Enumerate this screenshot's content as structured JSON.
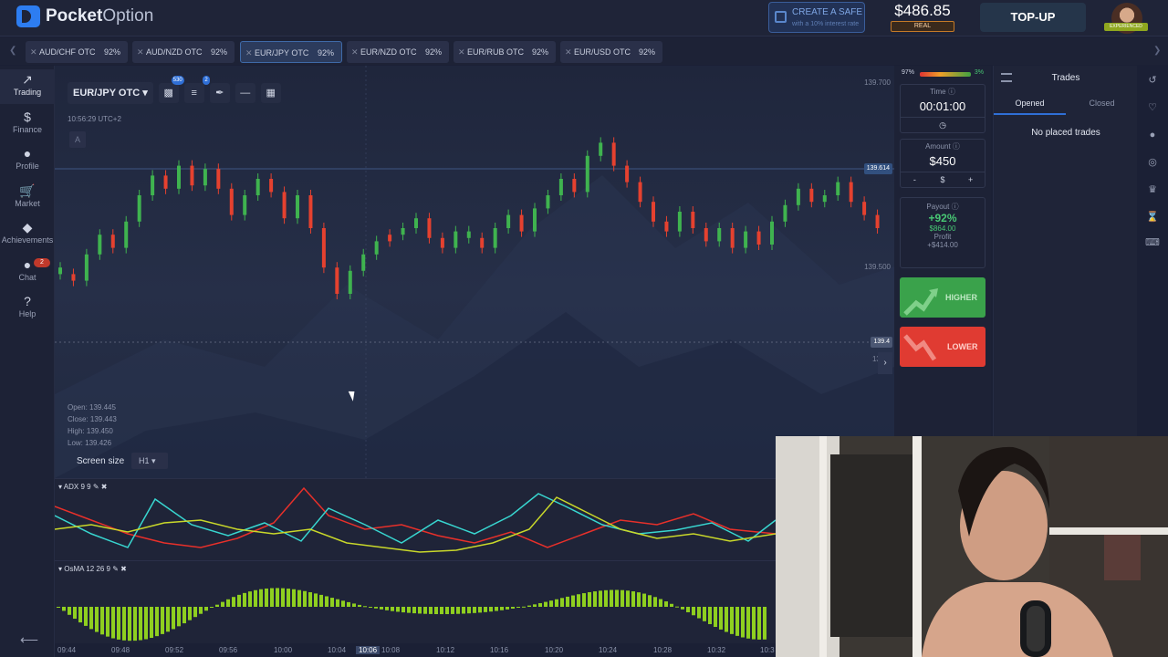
{
  "brand": {
    "name_bold": "Pocket",
    "name_light": "Option"
  },
  "promo": {
    "title": "CREATE A SAFE",
    "subtitle": "with a 10% interest rate"
  },
  "account": {
    "balance": "$486.85",
    "type": "REAL",
    "topup": "TOP-UP",
    "level_badge": "EXPERIENCED"
  },
  "tabs": [
    {
      "pair": "AUD/CHF OTC",
      "payout": "92%"
    },
    {
      "pair": "AUD/NZD OTC",
      "payout": "92%"
    },
    {
      "pair": "EUR/JPY OTC",
      "payout": "92%",
      "active": true
    },
    {
      "pair": "EUR/NZD OTC",
      "payout": "92%"
    },
    {
      "pair": "EUR/RUB OTC",
      "payout": "92%"
    },
    {
      "pair": "EUR/USD OTC",
      "payout": "92%"
    }
  ],
  "sidebar": {
    "items": [
      {
        "label": "Trading",
        "icon": "chart-icon"
      },
      {
        "label": "Finance",
        "icon": "dollar-icon"
      },
      {
        "label": "Profile",
        "icon": "user-icon"
      },
      {
        "label": "Market",
        "icon": "cart-icon"
      },
      {
        "label": "Achievements",
        "icon": "diamond-icon"
      },
      {
        "label": "Chat",
        "icon": "chat-icon",
        "badge": "2"
      },
      {
        "label": "Help",
        "icon": "help-icon"
      }
    ]
  },
  "chart": {
    "pair": "EUR/JPY OTC",
    "tool_badges": {
      "indicators": "530",
      "settings": "2"
    },
    "clock": "10:56:29 UTC+2",
    "drawing_mode": "A",
    "ohlc": {
      "open": "Open: 139.445",
      "close": "Close: 139.443",
      "high": "High: 139.450",
      "low": "Low: 139.426"
    },
    "screen_size_label": "Screen size",
    "timeframe": "H1",
    "price_ticks": [
      "139.700",
      "139.500",
      "139.4"
    ],
    "current_price": "139.614",
    "live_price": "139.4",
    "candles": [
      [
        "up",
        0.42,
        0.44
      ],
      [
        "dn",
        0.44,
        0.46
      ],
      [
        "up",
        0.46,
        0.38
      ],
      [
        "up",
        0.38,
        0.32
      ],
      [
        "dn",
        0.32,
        0.36
      ],
      [
        "up",
        0.36,
        0.28
      ],
      [
        "up",
        0.28,
        0.2
      ],
      [
        "up",
        0.2,
        0.14
      ],
      [
        "dn",
        0.14,
        0.18
      ],
      [
        "up",
        0.18,
        0.11
      ],
      [
        "dn",
        0.11,
        0.17
      ],
      [
        "up",
        0.17,
        0.12
      ],
      [
        "dn",
        0.12,
        0.18
      ],
      [
        "dn",
        0.18,
        0.26
      ],
      [
        "up",
        0.26,
        0.2
      ],
      [
        "up",
        0.2,
        0.15
      ],
      [
        "dn",
        0.15,
        0.19
      ],
      [
        "dn",
        0.19,
        0.27
      ],
      [
        "up",
        0.27,
        0.2
      ],
      [
        "dn",
        0.2,
        0.3
      ],
      [
        "dn",
        0.3,
        0.42
      ],
      [
        "dn",
        0.42,
        0.5
      ],
      [
        "up",
        0.5,
        0.43
      ],
      [
        "up",
        0.43,
        0.38
      ],
      [
        "up",
        0.38,
        0.34
      ],
      [
        "dn",
        0.34,
        0.32
      ],
      [
        "up",
        0.32,
        0.3
      ],
      [
        "up",
        0.3,
        0.27
      ],
      [
        "dn",
        0.27,
        0.33
      ],
      [
        "dn",
        0.33,
        0.36
      ],
      [
        "up",
        0.36,
        0.31
      ],
      [
        "up",
        0.31,
        0.33
      ],
      [
        "dn",
        0.33,
        0.36
      ],
      [
        "up",
        0.36,
        0.3
      ],
      [
        "up",
        0.3,
        0.26
      ],
      [
        "dn",
        0.26,
        0.31
      ],
      [
        "up",
        0.31,
        0.24
      ],
      [
        "up",
        0.24,
        0.2
      ],
      [
        "up",
        0.2,
        0.15
      ],
      [
        "dn",
        0.15,
        0.19
      ],
      [
        "up",
        0.19,
        0.08
      ],
      [
        "up",
        0.08,
        0.04
      ],
      [
        "dn",
        0.04,
        0.11
      ],
      [
        "dn",
        0.11,
        0.16
      ],
      [
        "dn",
        0.16,
        0.22
      ],
      [
        "dn",
        0.22,
        0.28
      ],
      [
        "dn",
        0.28,
        0.31
      ],
      [
        "up",
        0.31,
        0.25
      ],
      [
        "dn",
        0.25,
        0.3
      ],
      [
        "dn",
        0.3,
        0.34
      ],
      [
        "up",
        0.34,
        0.3
      ],
      [
        "dn",
        0.3,
        0.36
      ],
      [
        "up",
        0.36,
        0.31
      ],
      [
        "dn",
        0.31,
        0.35
      ],
      [
        "up",
        0.35,
        0.28
      ],
      [
        "up",
        0.28,
        0.23
      ],
      [
        "up",
        0.23,
        0.18
      ],
      [
        "dn",
        0.18,
        0.22
      ],
      [
        "up",
        0.22,
        0.2
      ],
      [
        "up",
        0.2,
        0.16
      ],
      [
        "dn",
        0.16,
        0.22
      ],
      [
        "dn",
        0.22,
        0.26
      ],
      [
        "dn",
        0.26,
        0.3
      ]
    ],
    "adx_label": "ADX 9 9",
    "osma_label": "OsMA 12 26 9",
    "time_ticks": [
      "09:44",
      "09:48",
      "09:52",
      "09:56",
      "10:00",
      "10:04",
      "10:06",
      "10:08",
      "10:12",
      "10:16",
      "10:20",
      "10:24",
      "10:28",
      "10:32",
      "10:3"
    ]
  },
  "trade": {
    "sentiment_down": "97%",
    "sentiment_up": "3%",
    "time_title": "Time",
    "time_value": "00:01:00",
    "amount_title": "Amount",
    "amount_value": "$450",
    "amount_minus": "-",
    "amount_currency": "$",
    "amount_plus": "+",
    "payout_title": "Payout",
    "payout_pct": "+92%",
    "payout_amount": "$864.00",
    "profit_title": "Profit",
    "profit_amount": "+$414.00",
    "higher": "HIGHER",
    "lower": "LOWER"
  },
  "trades": {
    "title": "Trades",
    "tab_opened": "Opened",
    "tab_closed": "Closed",
    "empty": "No placed trades"
  },
  "colors": {
    "up": "#3fb34f",
    "down": "#e5412f",
    "accent": "#2f6fd6"
  }
}
